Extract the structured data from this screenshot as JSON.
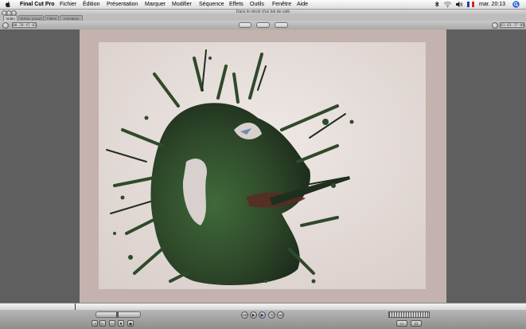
{
  "menubar": {
    "app_name": "Final Cut Pro",
    "items": [
      "Fichier",
      "Édition",
      "Présentation",
      "Marquer",
      "Modifier",
      "Séquence",
      "Effets",
      "Outils",
      "Fenêtre",
      "Aide"
    ],
    "clock": "mar. 20:13",
    "status_icons": [
      "bluetooth-icon",
      "wifi-icon",
      "volume-icon",
      "flag-fr-icon",
      "spotlight-icon"
    ]
  },
  "window": {
    "title": "Dans le miroir d'un bol de café"
  },
  "tabs": [
    "Vidéo",
    "Stéréo (a1a2)",
    "Filtres",
    "Animation"
  ],
  "viewer": {
    "duration_tc": "00:28:41:03",
    "current_tc": "01:03:37:09"
  },
  "colors": {
    "frame_bg": "#c3b2ad",
    "paint_green": "#2f4a2a",
    "paint_dark": "#1f2f1e",
    "paint_red": "#5a2a23",
    "accent_blue": "#6f8bb2"
  },
  "transport": {
    "buttons": [
      "go-to-in-icon",
      "play-in-to-out-icon",
      "play-icon",
      "play-around-icon",
      "go-to-out-icon"
    ],
    "left_buttons": [
      "mark-in-icon",
      "mark-out-icon",
      "mark-clip-icon",
      "add-marker-icon",
      "keyframe-icon"
    ]
  }
}
